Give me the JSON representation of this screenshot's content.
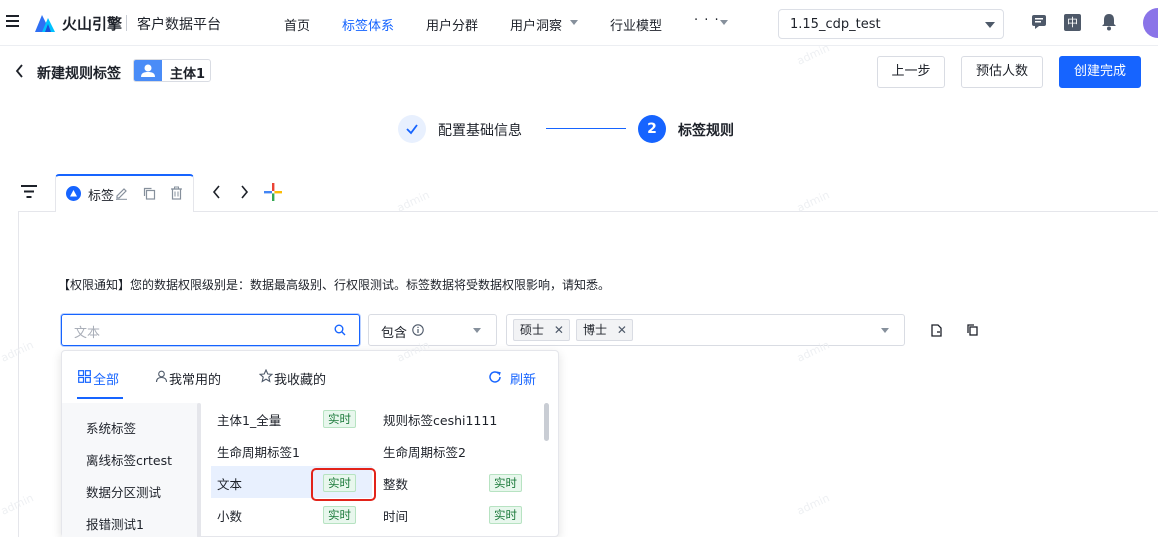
{
  "nav": {
    "brand": "火山引擎",
    "product": "客户数据平台",
    "items": [
      {
        "label": "首页",
        "active": false,
        "dropdown": false
      },
      {
        "label": "标签体系",
        "active": true,
        "dropdown": false
      },
      {
        "label": "用户分群",
        "active": false,
        "dropdown": false
      },
      {
        "label": "用户洞察",
        "active": false,
        "dropdown": true
      },
      {
        "label": "行业模型",
        "active": false,
        "dropdown": false
      },
      {
        "label": "· · ·",
        "active": false,
        "dropdown": true
      }
    ],
    "env_select": "1.15_cdp_test",
    "lang_badge": "中"
  },
  "header": {
    "title": "新建规则标签",
    "entity_badge": "主体1",
    "prev_button": "上一步",
    "estimate_button": "预估人数",
    "create_button": "创建完成"
  },
  "steps": [
    {
      "label": "配置基础信息",
      "state": "done"
    },
    {
      "index": "2",
      "label": "标签规则",
      "state": "active"
    }
  ],
  "rule_tab": {
    "label": "标签"
  },
  "permission_notice": "【权限通知】您的数据权限级别是：数据最高级别、行权限测试。标签数据将受数据权限影响，请知悉。",
  "condition": {
    "search_placeholder": "文本",
    "operator": "包含",
    "values": [
      "硕士",
      "博士"
    ]
  },
  "picker": {
    "tabs": [
      {
        "label": "全部",
        "active": true
      },
      {
        "label": "我常用的",
        "active": false
      },
      {
        "label": "我收藏的",
        "active": false
      }
    ],
    "refresh_label": "刷新",
    "categories": [
      "系统标签",
      "离线标签crtest",
      "数据分区测试",
      "报错测试1"
    ],
    "options": [
      {
        "name": "主体1_全量",
        "badge": "实时"
      },
      {
        "name": "规则标签ceshi1111",
        "badge": ""
      },
      {
        "name": "生命周期标签1",
        "badge": ""
      },
      {
        "name": "生命周期标签2",
        "badge": ""
      },
      {
        "name": "文本",
        "badge": "实时",
        "highlighted": true
      },
      {
        "name": "整数",
        "badge": "实时"
      },
      {
        "name": "小数",
        "badge": "实时"
      },
      {
        "name": "时间",
        "badge": "实时"
      }
    ]
  },
  "watermark": "admin",
  "colors": {
    "primary": "#1664ff",
    "realtime_badge_bg": "#e8f7ed",
    "realtime_badge_text": "#1b7a3a",
    "highlight_border": "#e2231a"
  }
}
